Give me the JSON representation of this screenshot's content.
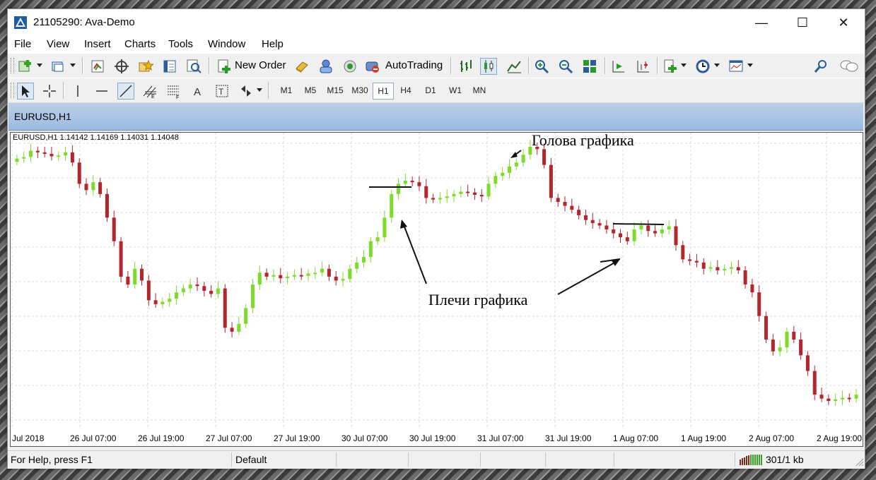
{
  "window": {
    "title": "21105290: Ava-Demo",
    "controls": {
      "minimize": "—",
      "maximize": "☐",
      "close": "✕"
    }
  },
  "menu": [
    "File",
    "View",
    "Insert",
    "Charts",
    "Tools",
    "Window",
    "Help"
  ],
  "toolbar": {
    "new_order_label": "New Order",
    "autotrading_label": "AutoTrading",
    "timeframes": [
      "M1",
      "M5",
      "M15",
      "M30",
      "H1",
      "H4",
      "D1",
      "W1",
      "MN"
    ],
    "active_timeframe": "H1"
  },
  "chart_tab": {
    "title": "EURUSD,H1"
  },
  "chart": {
    "info_line": "EURUSD,H1  1.14142 1.14169 1.14031 1.14048",
    "annotations": {
      "head": "Голова графика",
      "shoulders": "Плечи графика"
    },
    "colors": {
      "bull": "#7ddc2a",
      "bear": "#b2262c",
      "grid": "#d8d8d8"
    },
    "x_labels": [
      "Jul 2018",
      "26 Jul 07:00",
      "26 Jul 19:00",
      "27 Jul 07:00",
      "27 Jul 19:00",
      "30 Jul 07:00",
      "30 Jul 19:00",
      "31 Jul 07:00",
      "31 Jul 19:00",
      "1 Aug 07:00",
      "1 Aug 19:00",
      "2 Aug 07:00",
      "2 Aug 19:00"
    ]
  },
  "chart_data": {
    "type": "candlestick",
    "symbol": "EURUSD",
    "timeframe": "H1",
    "last_bar": {
      "open": 1.14142,
      "high": 1.14169,
      "low": 1.14031,
      "close": 1.14048
    },
    "close_path_relative": [
      240,
      238,
      230,
      232,
      234,
      237,
      236,
      232,
      245,
      272,
      280,
      270,
      285,
      315,
      345,
      390,
      400,
      380,
      395,
      420,
      425,
      422,
      418,
      410,
      405,
      400,
      402,
      408,
      412,
      405,
      455,
      460,
      450,
      430,
      400,
      385,
      390,
      388,
      392,
      390,
      388,
      389,
      386,
      385,
      380,
      390,
      395,
      393,
      380,
      372,
      365,
      345,
      340,
      315,
      285,
      272,
      268,
      270,
      275,
      290,
      292,
      290,
      288,
      285,
      282,
      283,
      286,
      288,
      272,
      262,
      258,
      250,
      245,
      235,
      225,
      228,
      248,
      290,
      295,
      300,
      305,
      312,
      318,
      322,
      325,
      330,
      335,
      340,
      345,
      330,
      325,
      332,
      335,
      330,
      326,
      350,
      368,
      370,
      372,
      380,
      378,
      382,
      380,
      378,
      382,
      400,
      410,
      440,
      470,
      485,
      480,
      460,
      470,
      490,
      510,
      540,
      545,
      548,
      546,
      544,
      545,
      540
    ]
  },
  "status": {
    "help": "For Help, press F1",
    "profile": "Default",
    "traffic": "301/1 kb"
  }
}
